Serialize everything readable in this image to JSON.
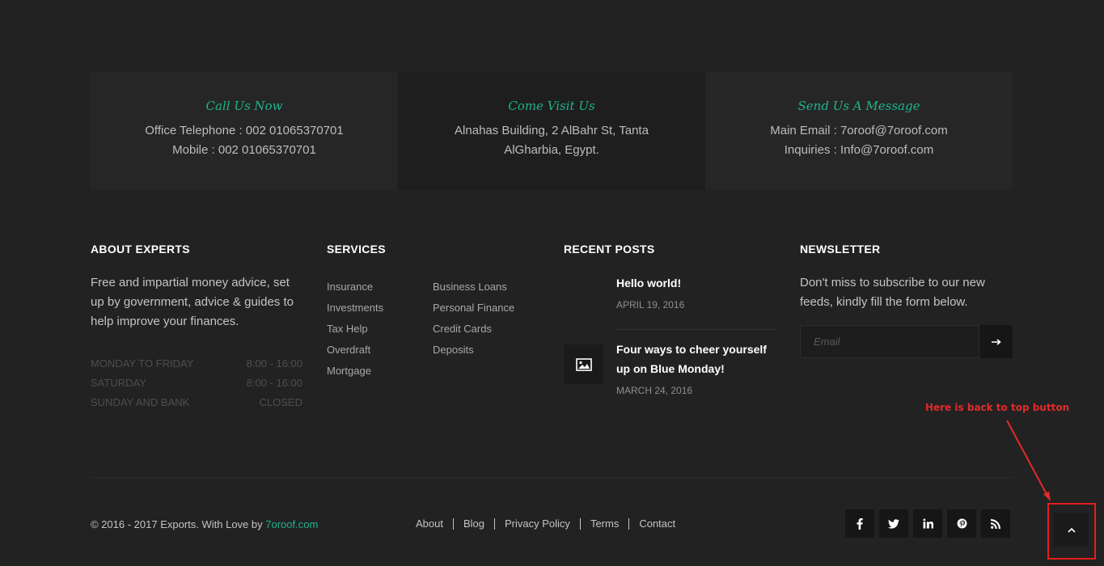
{
  "contact": [
    {
      "title": "Call Us Now",
      "lines": [
        "Office Telephone : 002 01065370701",
        "Mobile : 002 01065370701"
      ]
    },
    {
      "title": "Come Visit Us",
      "lines": [
        "Alnahas Building, 2 AlBahr St, Tanta",
        "AlGharbia, Egypt."
      ]
    },
    {
      "title": "Send Us A Message",
      "lines": [
        "Main Email : 7oroof@7oroof.com",
        "Inquiries : Info@7oroof.com"
      ]
    }
  ],
  "about": {
    "title": "ABOUT EXPERTS",
    "text": "Free and impartial money advice, set up by government, advice & guides to help improve your finances.",
    "hours": [
      {
        "label": "MONDAY TO FRIDAY",
        "value": "8:00 - 16:00"
      },
      {
        "label": "SATURDAY",
        "value": "8:00 - 16:00"
      },
      {
        "label": "SUNDAY AND BANK",
        "value": "CLOSED"
      }
    ]
  },
  "services": {
    "title": "SERVICES",
    "col1": [
      "Insurance",
      "Investments",
      "Tax Help",
      "Overdraft",
      "Mortgage"
    ],
    "col2": [
      "Business Loans",
      "Personal Finance",
      "Credit Cards",
      "Deposits"
    ]
  },
  "recent_posts": {
    "title": "RECENT POSTS",
    "posts": [
      {
        "title": "Hello world!",
        "date": "APRIL 19, 2016"
      },
      {
        "title": "Four ways to cheer yourself up on Blue Monday!",
        "date": "MARCH 24, 2016",
        "icon": "image-icon"
      }
    ]
  },
  "newsletter": {
    "title": "NEWSLETTER",
    "text": "Don't miss to subscribe to our new feeds, kindly fill the form below.",
    "placeholder": "Email",
    "submit_icon": "arrow-right-icon"
  },
  "footer": {
    "copyright_prefix": "© 2016 - 2017 Exports. With Love by ",
    "brand": "7oroof.com",
    "brand_color": "#1fb48a",
    "nav": [
      "About",
      "Blog",
      "Privacy Policy",
      "Terms",
      "Contact"
    ],
    "social": [
      "facebook-icon",
      "twitter-icon",
      "linkedin-icon",
      "pinterest-icon",
      "rss-icon"
    ]
  },
  "annotation": {
    "text": "Here is back to top button",
    "color": "#e22a2a"
  },
  "back_to_top": {
    "icon": "chevron-up-icon"
  }
}
